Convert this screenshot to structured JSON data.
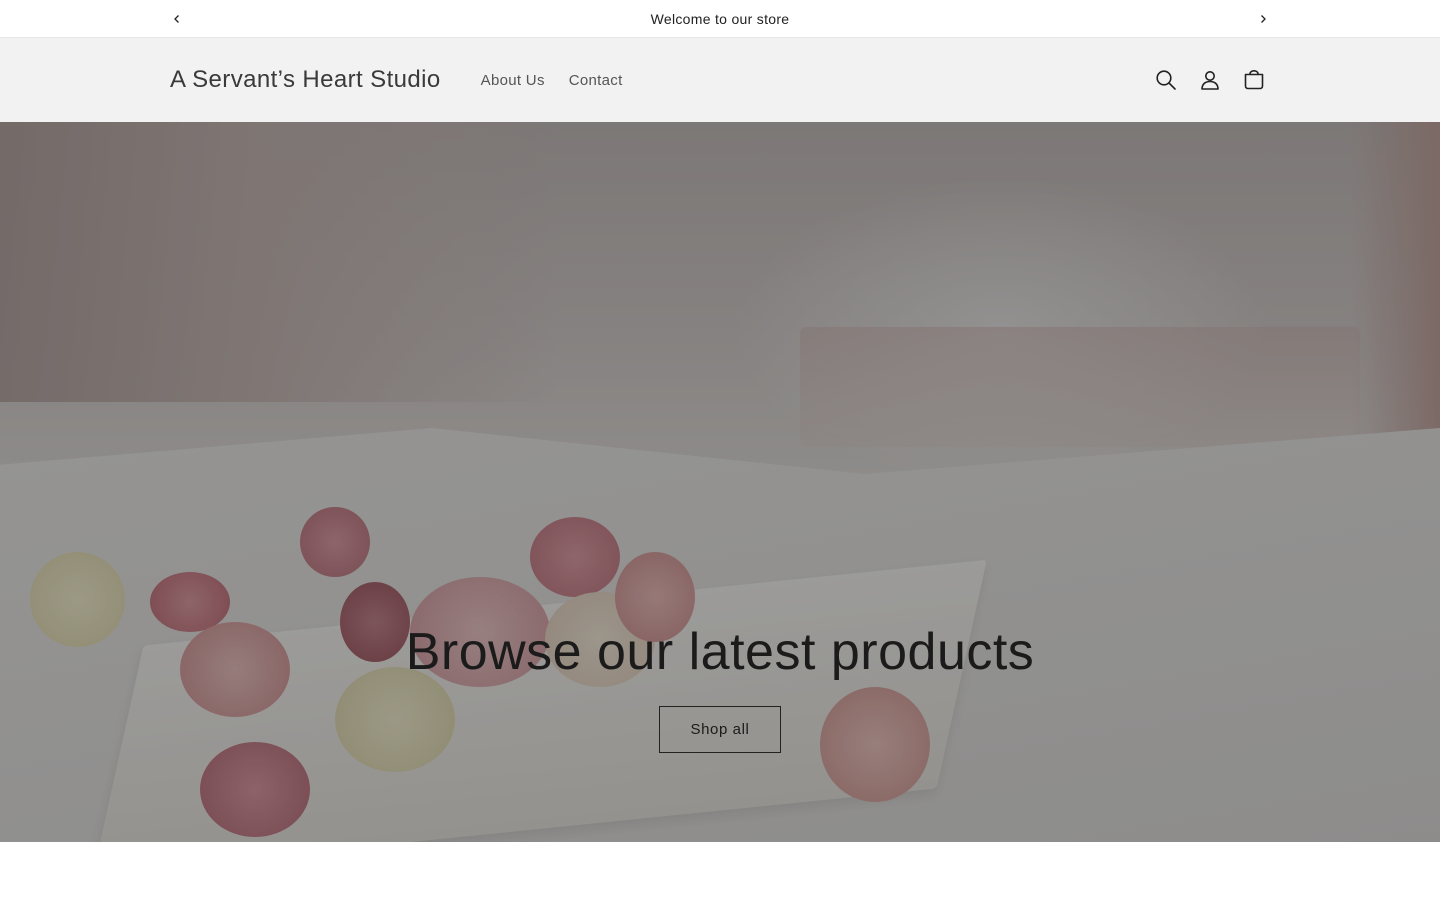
{
  "announcement": {
    "text": "Welcome to our store",
    "prev_icon": "chevron-left-icon",
    "next_icon": "chevron-right-icon"
  },
  "header": {
    "logo": "A Servant’s Heart Studio",
    "nav": [
      {
        "label": "About Us"
      },
      {
        "label": "Contact"
      }
    ],
    "icons": [
      "search-icon",
      "account-icon",
      "cart-icon"
    ]
  },
  "hero": {
    "title": "Browse our latest products",
    "button_label": "Shop all"
  },
  "colors": {
    "header_bg": "#f2f2f2",
    "text": "#121212",
    "overlay": "rgba(0,0,0,0.38)"
  }
}
